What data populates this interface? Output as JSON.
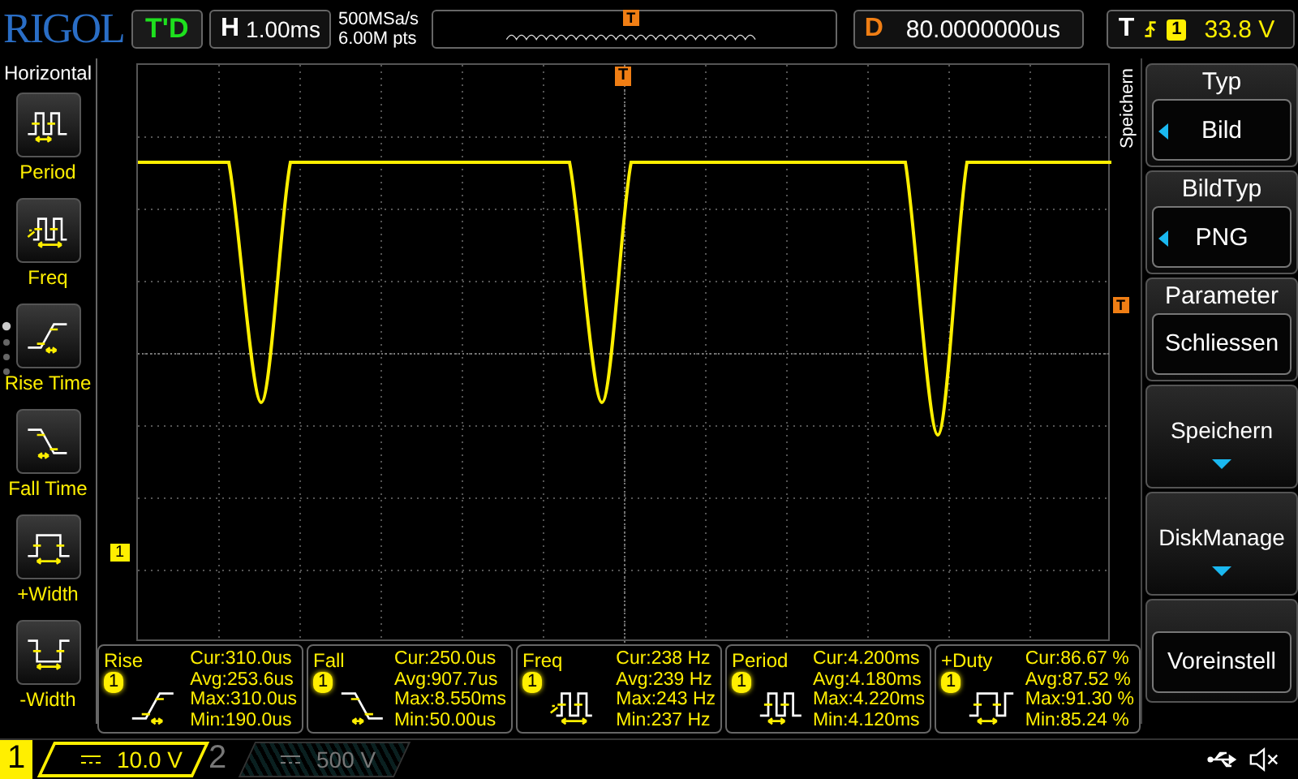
{
  "top_bar": {
    "logo": "RIGOL",
    "run_status": "T'D",
    "timebase": {
      "label": "H",
      "value": "1.00ms"
    },
    "sample_rate": "500MSa/s",
    "memory_depth": "6.00M pts",
    "overview_marker": "T",
    "delay": {
      "label": "D",
      "value": "80.0000000us"
    },
    "trigger": {
      "label": "T",
      "source": "1",
      "level": "33.8 V"
    }
  },
  "left_menu": {
    "title": "Horizontal",
    "items": [
      {
        "label": "Period",
        "kind": "period"
      },
      {
        "label": "Freq",
        "kind": "freq"
      },
      {
        "label": "Rise Time",
        "kind": "rise"
      },
      {
        "label": "Fall Time",
        "kind": "fall"
      },
      {
        "label": "+Width",
        "kind": "pwidth"
      },
      {
        "label": "-Width",
        "kind": "nwidth"
      }
    ]
  },
  "screen": {
    "trigger_position_marker": "T",
    "trigger_level_marker": "T",
    "channel_marker": "1",
    "side_label": "Speichern"
  },
  "measurements": [
    {
      "name": "Rise",
      "source": "1",
      "kind": "rise",
      "lines": [
        "Cur:310.0us",
        "Avg:253.6us",
        "Max:310.0us",
        "Min:190.0us"
      ]
    },
    {
      "name": "Fall",
      "source": "1",
      "kind": "fall",
      "lines": [
        "Cur:250.0us",
        "Avg:907.7us",
        "Max:8.550ms",
        "Min:50.00us"
      ]
    },
    {
      "name": "Freq",
      "source": "1",
      "kind": "freq",
      "lines": [
        "Cur:238 Hz",
        "Avg:239 Hz",
        "Max:243 Hz",
        "Min:237 Hz"
      ]
    },
    {
      "name": "Period",
      "source": "1",
      "kind": "period",
      "lines": [
        "Cur:4.200ms",
        "Avg:4.180ms",
        "Max:4.220ms",
        "Min:4.120ms"
      ]
    },
    {
      "name": "+Duty",
      "source": "1",
      "kind": "duty",
      "lines": [
        "Cur:86.67 %",
        "Avg:87.52 %",
        "Max:91.30 %",
        "Min:85.24 %"
      ]
    }
  ],
  "right_menu": {
    "items": [
      {
        "kind": "option",
        "title": "Typ",
        "value": "Bild"
      },
      {
        "kind": "option",
        "title": "BildTyp",
        "value": "PNG"
      },
      {
        "kind": "box",
        "title": "Parameter",
        "value": "Schliessen"
      },
      {
        "kind": "submenu",
        "label": "Speichern"
      },
      {
        "kind": "submenu",
        "label": "DiskManage"
      },
      {
        "kind": "action",
        "label": "Voreinstell"
      }
    ]
  },
  "channels": [
    {
      "number": "1",
      "scale": "10.0 V",
      "on": true
    },
    {
      "number": "2",
      "scale": "500 V",
      "on": false
    }
  ]
}
